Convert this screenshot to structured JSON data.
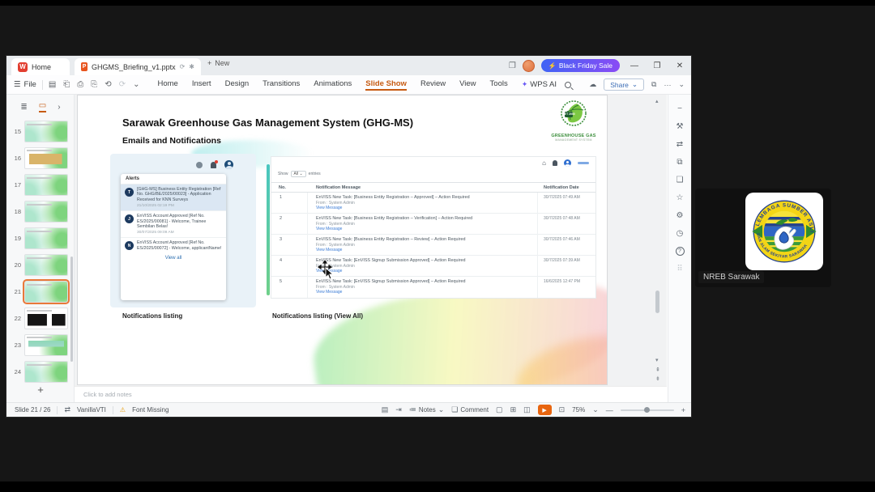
{
  "icons": {
    "hamburger": "☰",
    "save": "▤",
    "output": "⎗",
    "print": "⎙",
    "print_preview": "⎘",
    "undo": "⟲",
    "redo": "⟳",
    "chevron_down": "⌄",
    "chevron_right": "›",
    "cloud": "☁",
    "more": "···",
    "window_restore": "❐",
    "minimize": "—",
    "close": "✕",
    "plus": "+",
    "sparkle": "✦",
    "lightning": "⚡",
    "warning": "⚠",
    "star": "☆",
    "gear": "⚙",
    "clock": "◷",
    "tools": "⚒",
    "translate": "⇄",
    "shapes": "⧉",
    "comment_bubble": "❏",
    "apps_grid": "⠿",
    "panel_minus": "−",
    "help": "?",
    "play": "▶",
    "fit": "⊡",
    "arrow_up": "▴",
    "arrow_down": "▾",
    "page_up": "⇞",
    "page_down": "⇟",
    "home_glyph": "⌂",
    "info_glyph": "ⓘ",
    "notes_glyph": "≔",
    "outline_view": "≣",
    "slide_view": "▭",
    "asterisk": "✱",
    "sync": "⟳",
    "view_normal": "▢",
    "view_sorter": "⊞",
    "view_read": "◫",
    "jump": "⇥",
    "note_page": "▤"
  },
  "window": {
    "home_tab": "Home",
    "doc_tab": "GHGMS_Briefing_v1.pptx",
    "new_label": "New",
    "promo_label": "Black Friday Sale",
    "file_label": "File",
    "menus": [
      "Home",
      "Insert",
      "Design",
      "Transitions",
      "Animations",
      "Slide Show",
      "Review",
      "View",
      "Tools"
    ],
    "wps_ai_label": "WPS AI",
    "share_label": "Share"
  },
  "slides_panel": {
    "items": [
      {
        "num": "15"
      },
      {
        "num": "16"
      },
      {
        "num": "17"
      },
      {
        "num": "18"
      },
      {
        "num": "19"
      },
      {
        "num": "20"
      },
      {
        "num": "21"
      },
      {
        "num": "22"
      },
      {
        "num": "23"
      },
      {
        "num": "24"
      }
    ],
    "selected": "21"
  },
  "slide": {
    "title": "Sarawak Greenhouse Gas Management System (GHG-MS)",
    "subtitle": "Emails and Notifications",
    "logo": {
      "badge": "NET 2050",
      "line1": "GREENHOUSE GAS",
      "line2": "MANAGEMENT SYSTEM"
    },
    "caption_left": "Notifications listing",
    "caption_right": "Notifications listing (View All)",
    "alerts_popup": {
      "header": "Alerts",
      "items": [
        {
          "avatar": "T",
          "text": "[GHG-MS] Business Entity Registration [Ref No. GHG/BE/2025/00023] - Application Received for KNN Surveys",
          "time": "21/10/2025 02:19 PM"
        },
        {
          "avatar": "J",
          "text": "EnVISS Account Approved [Ref No. ES/2025/00081] - Welcome, Trainee Sembilan Belas!",
          "time": "30/07/2025 09:09 AM"
        },
        {
          "avatar": "N",
          "text": "EnVISS Account Approved [Ref No. ES/2025/00072] - Welcome, applicantName!",
          "time": ""
        }
      ],
      "footer": "View all"
    },
    "table": {
      "show_label": "Show",
      "show_value": "All",
      "entries_label": "entries",
      "headers": [
        "No.",
        "Notification Message",
        "Notification Date"
      ],
      "rows": [
        {
          "no": "1",
          "message": "EnVISS New Task: [Business Entity Registration – Approved] – Action Required",
          "from": "From : System Admin",
          "link": "View Message",
          "date": "30/7/2025 07:49 AM"
        },
        {
          "no": "2",
          "message": "EnVISS New Task: [Business Entity Registration – Verification] – Action Required",
          "from": "From : System Admin",
          "link": "View Message",
          "date": "30/7/2025 07:48 AM"
        },
        {
          "no": "3",
          "message": "EnVISS New Task: [Business Entity Registration – Review] – Action Required",
          "from": "From : System Admin",
          "link": "View Message",
          "date": "30/7/2025 07:46 AM"
        },
        {
          "no": "4",
          "message": "EnVISS New Task: [EnVISS Signup Submission Approved] – Action Required",
          "from": "From : System Admin",
          "link": "View Message",
          "date": "30/7/2025 07:39 AM"
        },
        {
          "no": "5",
          "message": "EnVISS New Task: [EnVISS Signup Submission Approved] – Action Required",
          "from": "From : System Admin",
          "link": "View Message",
          "date": "16/6/2025 12:47 PM"
        }
      ]
    }
  },
  "notes_placeholder": "Click to add notes",
  "statusbar": {
    "slide_indicator": "Slide 21 / 26",
    "theme_name": "VanillaVTI",
    "font_warning": "Font Missing",
    "notes_label": "Notes",
    "comment_label": "Comment",
    "zoom_percent": "75%"
  },
  "participant": {
    "name_label": "NREB Sarawak",
    "logo": {
      "arc_top": "LEMBAGA SUMBER ASLI",
      "arc_bottom": "DAN ALAM SEKITAR SARAWAK"
    }
  },
  "colors": {
    "accent_orange": "#c75b12",
    "promo_blue": "#3f63f5",
    "promo_purple": "#8a4bf5",
    "alert_highlight": "#dbe7f3",
    "link_blue": "#3a7bd5"
  }
}
